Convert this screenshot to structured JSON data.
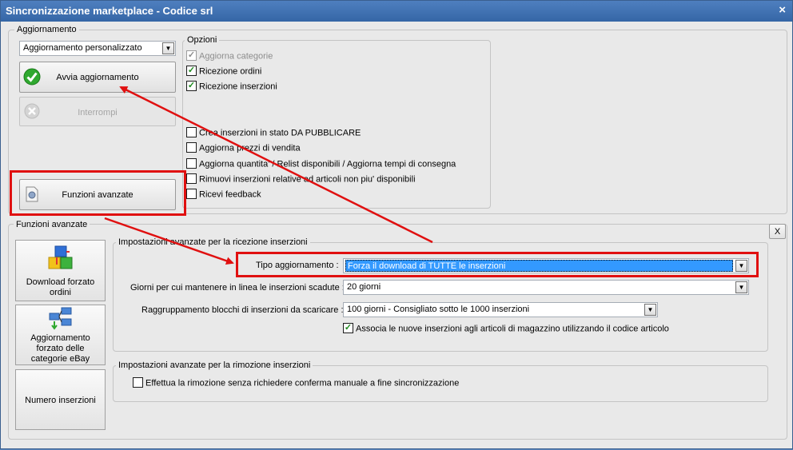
{
  "window": {
    "title": "Sincronizzazione marketplace - Codice srl",
    "close_label": "×"
  },
  "aggiornamento": {
    "legend": "Aggiornamento",
    "mode_value": "Aggiornamento personalizzato",
    "start_label": "Avvia aggiornamento",
    "stop_label": "Interrompi",
    "advanced_label": "Funzioni avanzate"
  },
  "opzioni": {
    "legend": "Opzioni",
    "items": [
      {
        "label": "Aggiorna categorie",
        "checked": true,
        "disabled": true
      },
      {
        "label": "Ricezione ordini",
        "checked": true,
        "disabled": false
      },
      {
        "label": "Ricezione inserzioni",
        "checked": true,
        "disabled": false
      },
      {
        "label": "Crea inserzioni in stato DA PUBBLICARE",
        "checked": false,
        "disabled": false
      },
      {
        "label": "Aggiorna prezzi di vendita",
        "checked": false,
        "disabled": false
      },
      {
        "label": "Aggiorna quantita' / Relist disponibili / Aggiorna tempi di consegna",
        "checked": false,
        "disabled": false
      },
      {
        "label": "Rimuovi inserzioni relative ad articoli non piu' disponibili",
        "checked": false,
        "disabled": false
      },
      {
        "label": "Ricevi feedback",
        "checked": false,
        "disabled": false
      }
    ]
  },
  "funzioni": {
    "legend": "Funzioni avanzate",
    "close_label": "X",
    "side_buttons": [
      {
        "label": "Download forzato ordini"
      },
      {
        "label": "Aggiornamento forzato delle categorie eBay"
      },
      {
        "label": "Numero inserzioni"
      }
    ],
    "ricezione": {
      "legend": "Impostazioni avanzate per la ricezione inserzioni",
      "tipo_label": "Tipo aggiornamento :",
      "tipo_value": "Forza il download di TUTTE le inserzioni",
      "giorni_label": "Giorni per cui mantenere in linea le inserzioni scadute :",
      "giorni_value": "20 giorni",
      "raggr_label": "Raggruppamento blocchi di inserzioni da scaricare :",
      "raggr_value": "100 giorni - Consigliato sotto le 1000 inserzioni",
      "associa_label": "Associa le nuove inserzioni agli articoli di magazzino utilizzando il codice articolo",
      "associa_checked": true
    },
    "rimozione": {
      "legend": "Impostazioni avanzate per la rimozione inserzioni",
      "effettua_label": "Effettua la rimozione senza richiedere conferma manuale a fine sincronizzazione",
      "effettua_checked": false
    }
  },
  "icons": {
    "start": "check-icon",
    "stop": "stop-icon",
    "advanced": "settings-icon",
    "download": "cubes-icon",
    "categories": "hierarchy-icon"
  },
  "colors": {
    "title_bar": "#3566a6",
    "annotation": "#e01010",
    "selection": "#3399ff"
  }
}
